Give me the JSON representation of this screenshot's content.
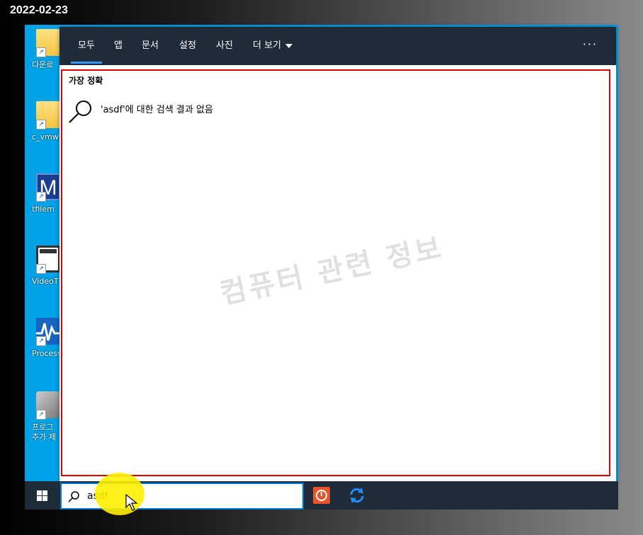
{
  "overlay": {
    "date": "2022-02-23"
  },
  "desktop": {
    "icons": [
      {
        "label": "다운로"
      },
      {
        "label": "c_vmw"
      },
      {
        "label": "tfilem"
      },
      {
        "label": "VideoT"
      },
      {
        "label": "Process"
      },
      {
        "label_line1": "프로그",
        "label_line2": "추가 제"
      }
    ]
  },
  "search_panel": {
    "tabs": [
      {
        "label": "모두",
        "active": true
      },
      {
        "label": "앱"
      },
      {
        "label": "문서"
      },
      {
        "label": "설정"
      },
      {
        "label": "사진"
      },
      {
        "label": "더 보기"
      }
    ],
    "more_icon": "ellipsis-icon",
    "best_match_heading": "가장 정확",
    "no_results_text": "'asdf'에 대한 검색 결과 없음",
    "watermark": "컴퓨터 관련 정보"
  },
  "taskbar": {
    "search_value": "asdf",
    "icons": [
      "windows-start-icon",
      "search-icon",
      "power-app-icon",
      "refresh-app-icon"
    ]
  },
  "colors": {
    "desktop": "#00a2e8",
    "tabbar": "#1f2b38",
    "accent": "#0078d7",
    "results_border": "#e00000"
  }
}
